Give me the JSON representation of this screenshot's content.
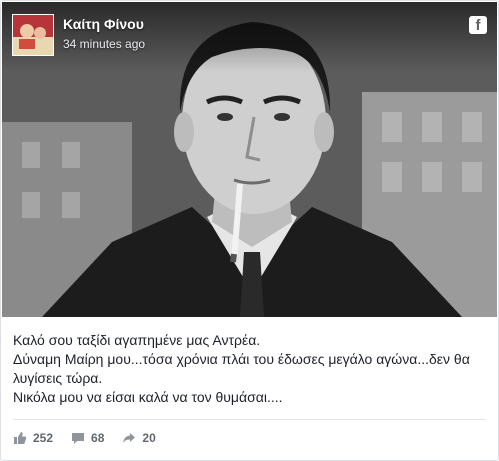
{
  "post": {
    "author": "Καίτη Φίνου",
    "time": "34 minutes ago",
    "lines": [
      "Καλό σου ταξίδι αγαπημένε μας Αντρέα.",
      "Δύναμη Μαίρη μου...τόσα χρόνια πλάι του έδωσες μεγάλο αγώνα...δεν θα λυγίσεις τώρα.",
      "Νικόλα μου να είσαι καλά να τον θυμάσαι...."
    ]
  },
  "stats": {
    "likes": "252",
    "comments": "68",
    "shares": "20"
  },
  "icons": {
    "facebook": "f",
    "like": "thumbs-up-icon",
    "comment": "comment-icon",
    "share": "share-icon"
  }
}
